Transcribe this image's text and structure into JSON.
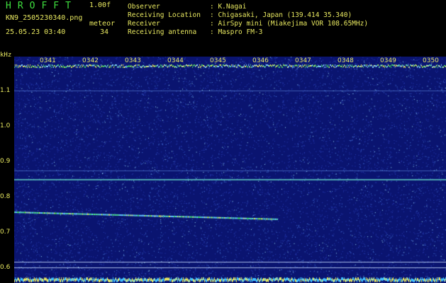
{
  "app": {
    "title": "HROFFT",
    "version": "1.00f"
  },
  "file": {
    "name": "KN9_2505230340.png",
    "datetime": "25.05.23 03:40",
    "mode": "meteor",
    "count": "34"
  },
  "info": [
    {
      "label": "Observer",
      "value": ": K.Nagai"
    },
    {
      "label": "Receiving Location",
      "value": ": Chigasaki, Japan (139.414 35.340)"
    },
    {
      "label": "Receiver",
      "value": ": AirSpy mini (Miakejima VOR 108.65MHz)"
    },
    {
      "label": "Receiving antenna",
      "value": ": Maspro FM-3"
    }
  ],
  "y_axis": {
    "unit": "kHz",
    "ticks": [
      "1.1",
      "1.0",
      "0.9",
      "0.8",
      "0.7",
      "0.6"
    ]
  },
  "x_axis": {
    "ticks": [
      "0341",
      "0342",
      "0343",
      "0344",
      "0345",
      "0346",
      "0347",
      "0348",
      "0349",
      "0350"
    ]
  },
  "colors": {
    "text": "#e8e860",
    "title": "#3fe03f",
    "background": "#0a1470"
  }
}
